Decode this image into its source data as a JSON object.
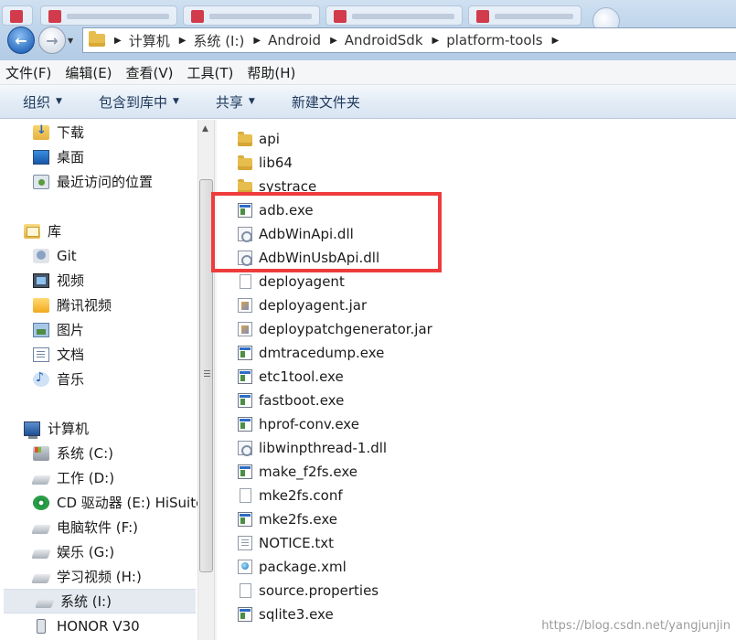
{
  "address_bar": {
    "crumbs": [
      "计算机",
      "系统 (I:)",
      "Android",
      "AndroidSdk",
      "platform-tools"
    ]
  },
  "menubar": [
    "文件(F)",
    "编辑(E)",
    "查看(V)",
    "工具(T)",
    "帮助(H)"
  ],
  "toolbar": {
    "organize": "组织",
    "include_in_library": "包含到库中",
    "share": "共享",
    "new_folder": "新建文件夹"
  },
  "nav": {
    "favorites": [
      {
        "label": "下载",
        "icon": "download-folder-icon"
      },
      {
        "label": "桌面",
        "icon": "desktop-icon"
      },
      {
        "label": "最近访问的位置",
        "icon": "recent-places-icon"
      }
    ],
    "libraries_header": "库",
    "libraries": [
      {
        "label": "Git",
        "icon": "git-library-icon"
      },
      {
        "label": "视频",
        "icon": "video-library-icon"
      },
      {
        "label": "腾讯视频",
        "icon": "tencent-video-icon"
      },
      {
        "label": "图片",
        "icon": "pictures-library-icon"
      },
      {
        "label": "文档",
        "icon": "documents-library-icon"
      },
      {
        "label": "音乐",
        "icon": "music-library-icon"
      }
    ],
    "computer_header": "计算机",
    "drives": [
      {
        "label": "系统 (C:)",
        "icon": "system-drive-icon"
      },
      {
        "label": "工作 (D:)",
        "icon": "drive-icon"
      },
      {
        "label": "CD 驱动器 (E:) HiSuite",
        "icon": "cd-drive-icon"
      },
      {
        "label": "电脑软件 (F:)",
        "icon": "drive-icon"
      },
      {
        "label": "娱乐 (G:)",
        "icon": "drive-icon"
      },
      {
        "label": "学习视频 (H:)",
        "icon": "drive-icon"
      },
      {
        "label": "系统 (I:)",
        "icon": "drive-icon",
        "selected": true
      },
      {
        "label": "HONOR V30",
        "icon": "phone-icon"
      }
    ]
  },
  "files": [
    {
      "name": "api",
      "type": "folder"
    },
    {
      "name": "lib64",
      "type": "folder"
    },
    {
      "name": "systrace",
      "type": "folder"
    },
    {
      "name": "adb.exe",
      "type": "exe"
    },
    {
      "name": "AdbWinApi.dll",
      "type": "dll"
    },
    {
      "name": "AdbWinUsbApi.dll",
      "type": "dll"
    },
    {
      "name": "deployagent",
      "type": "blank"
    },
    {
      "name": "deployagent.jar",
      "type": "jar"
    },
    {
      "name": "deploypatchgenerator.jar",
      "type": "jar"
    },
    {
      "name": "dmtracedump.exe",
      "type": "exe"
    },
    {
      "name": "etc1tool.exe",
      "type": "exe"
    },
    {
      "name": "fastboot.exe",
      "type": "exe"
    },
    {
      "name": "hprof-conv.exe",
      "type": "exe"
    },
    {
      "name": "libwinpthread-1.dll",
      "type": "dll"
    },
    {
      "name": "make_f2fs.exe",
      "type": "exe"
    },
    {
      "name": "mke2fs.conf",
      "type": "blank"
    },
    {
      "name": "mke2fs.exe",
      "type": "exe"
    },
    {
      "name": "NOTICE.txt",
      "type": "txt"
    },
    {
      "name": "package.xml",
      "type": "xml"
    },
    {
      "name": "source.properties",
      "type": "blank"
    },
    {
      "name": "sqlite3.exe",
      "type": "exe"
    }
  ],
  "highlight_color": "#ee3b3b",
  "watermark": "https://blog.csdn.net/yangjunjin"
}
